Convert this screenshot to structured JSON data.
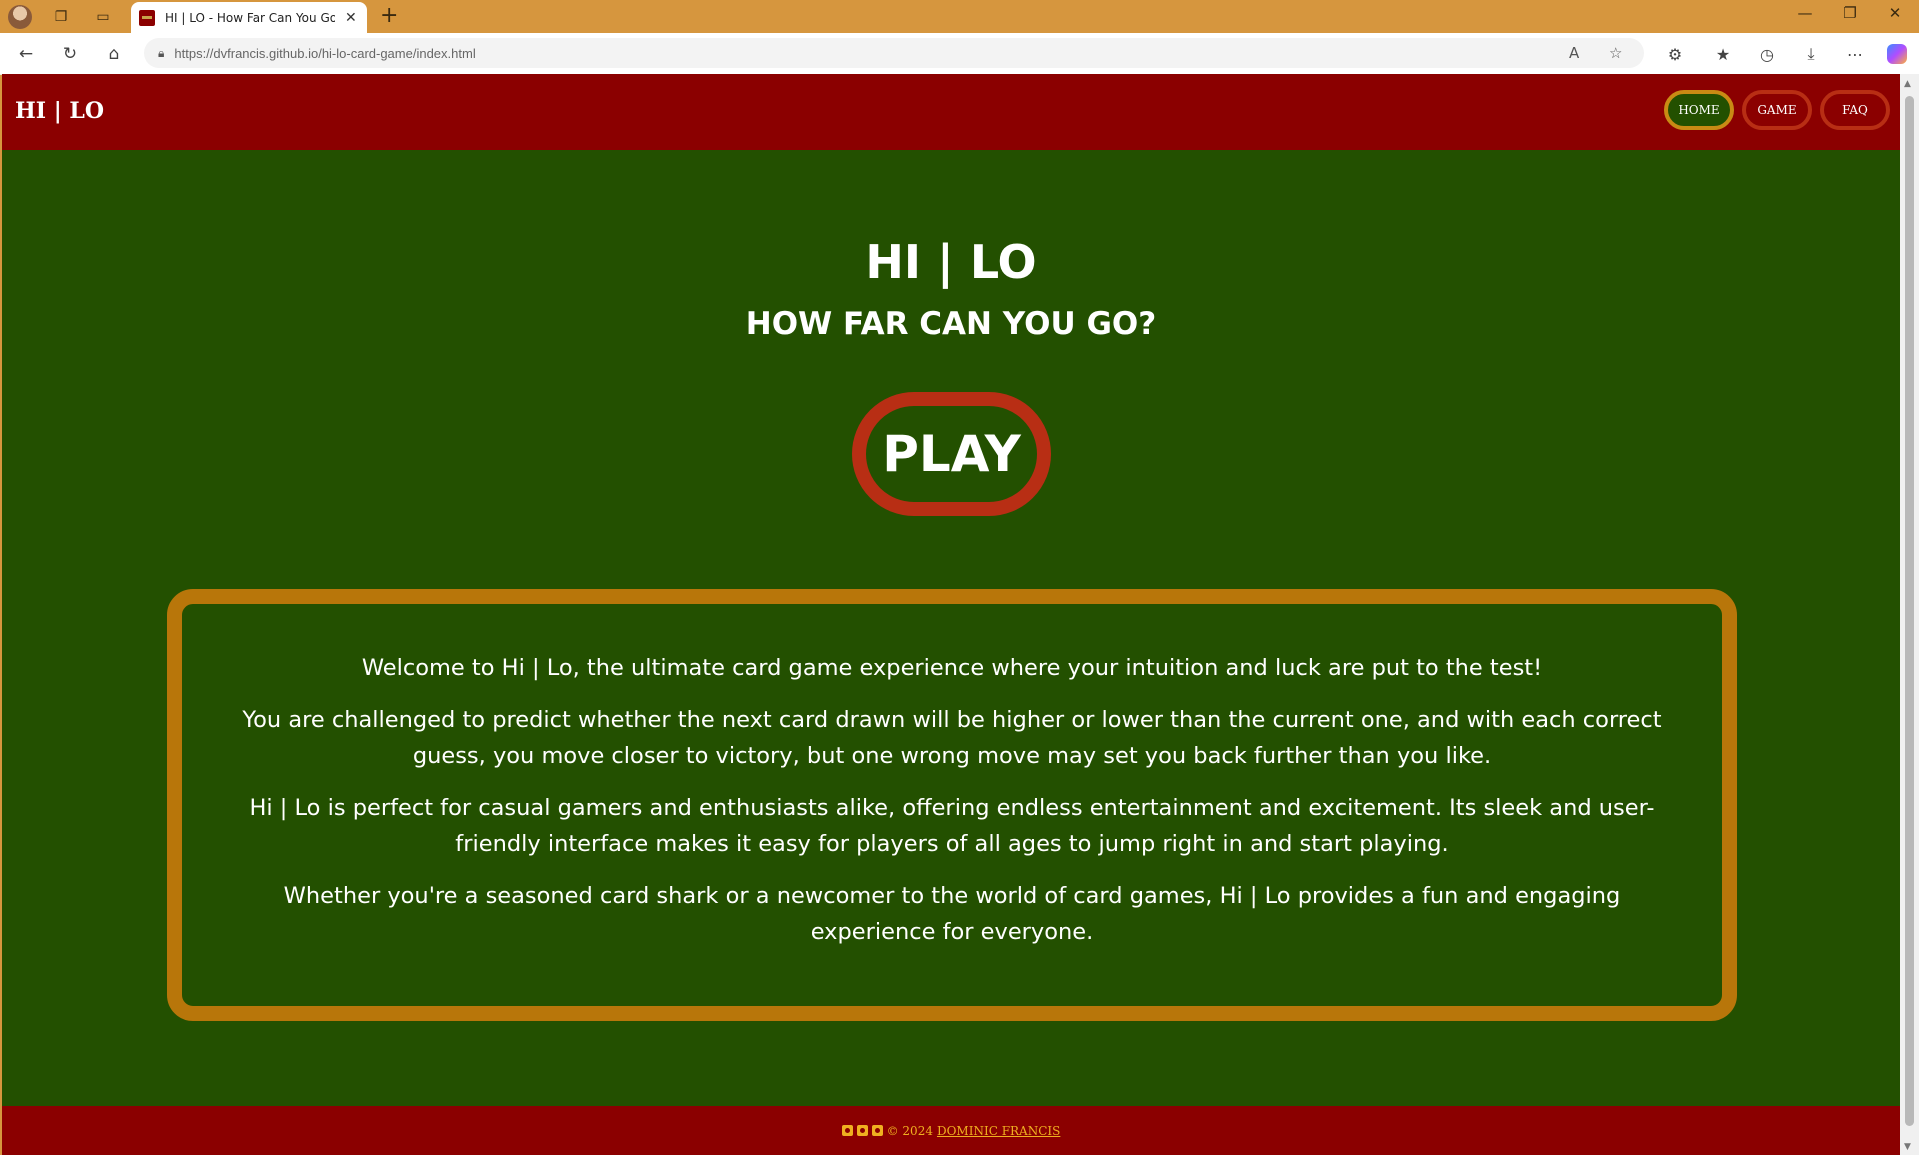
{
  "browser": {
    "tab_title": "HI | LO - How Far Can You Go?",
    "url_host": "https://dvfrancis.github.io",
    "url_path": "/hi-lo-card-game/index.html"
  },
  "site": {
    "logo": "HI | LO",
    "nav": [
      {
        "label": "HOME",
        "active": true
      },
      {
        "label": "GAME",
        "active": false
      },
      {
        "label": "FAQ",
        "active": false
      }
    ]
  },
  "hero": {
    "title": "HI | LO",
    "subtitle": "HOW FAR CAN YOU GO?",
    "play_label": "PLAY"
  },
  "info": {
    "paragraphs": [
      "Welcome to Hi | Lo, the ultimate card game experience where your intuition and luck are put to the test!",
      "You are challenged to predict whether the next card drawn will be higher or lower than the current one, and with each correct guess, you move closer to victory, but one wrong move may set you back further than you like.",
      "Hi | Lo is perfect for casual gamers and enthusiasts alike, offering endless entertainment and excitement. Its sleek and user-friendly interface makes it easy for players of all ages to jump right in and start playing.",
      "Whether you're a seasoned card shark or a newcomer to the world of card games, Hi | Lo provides a fun and engaging experience for everyone."
    ]
  },
  "footer": {
    "copyright": "© 2024",
    "author": "DOMINIC FRANCIS"
  },
  "colors": {
    "header_red": "#8b0000",
    "felt_green": "#235000",
    "gold_border": "#b8760a",
    "accent_red": "#b82e14"
  }
}
